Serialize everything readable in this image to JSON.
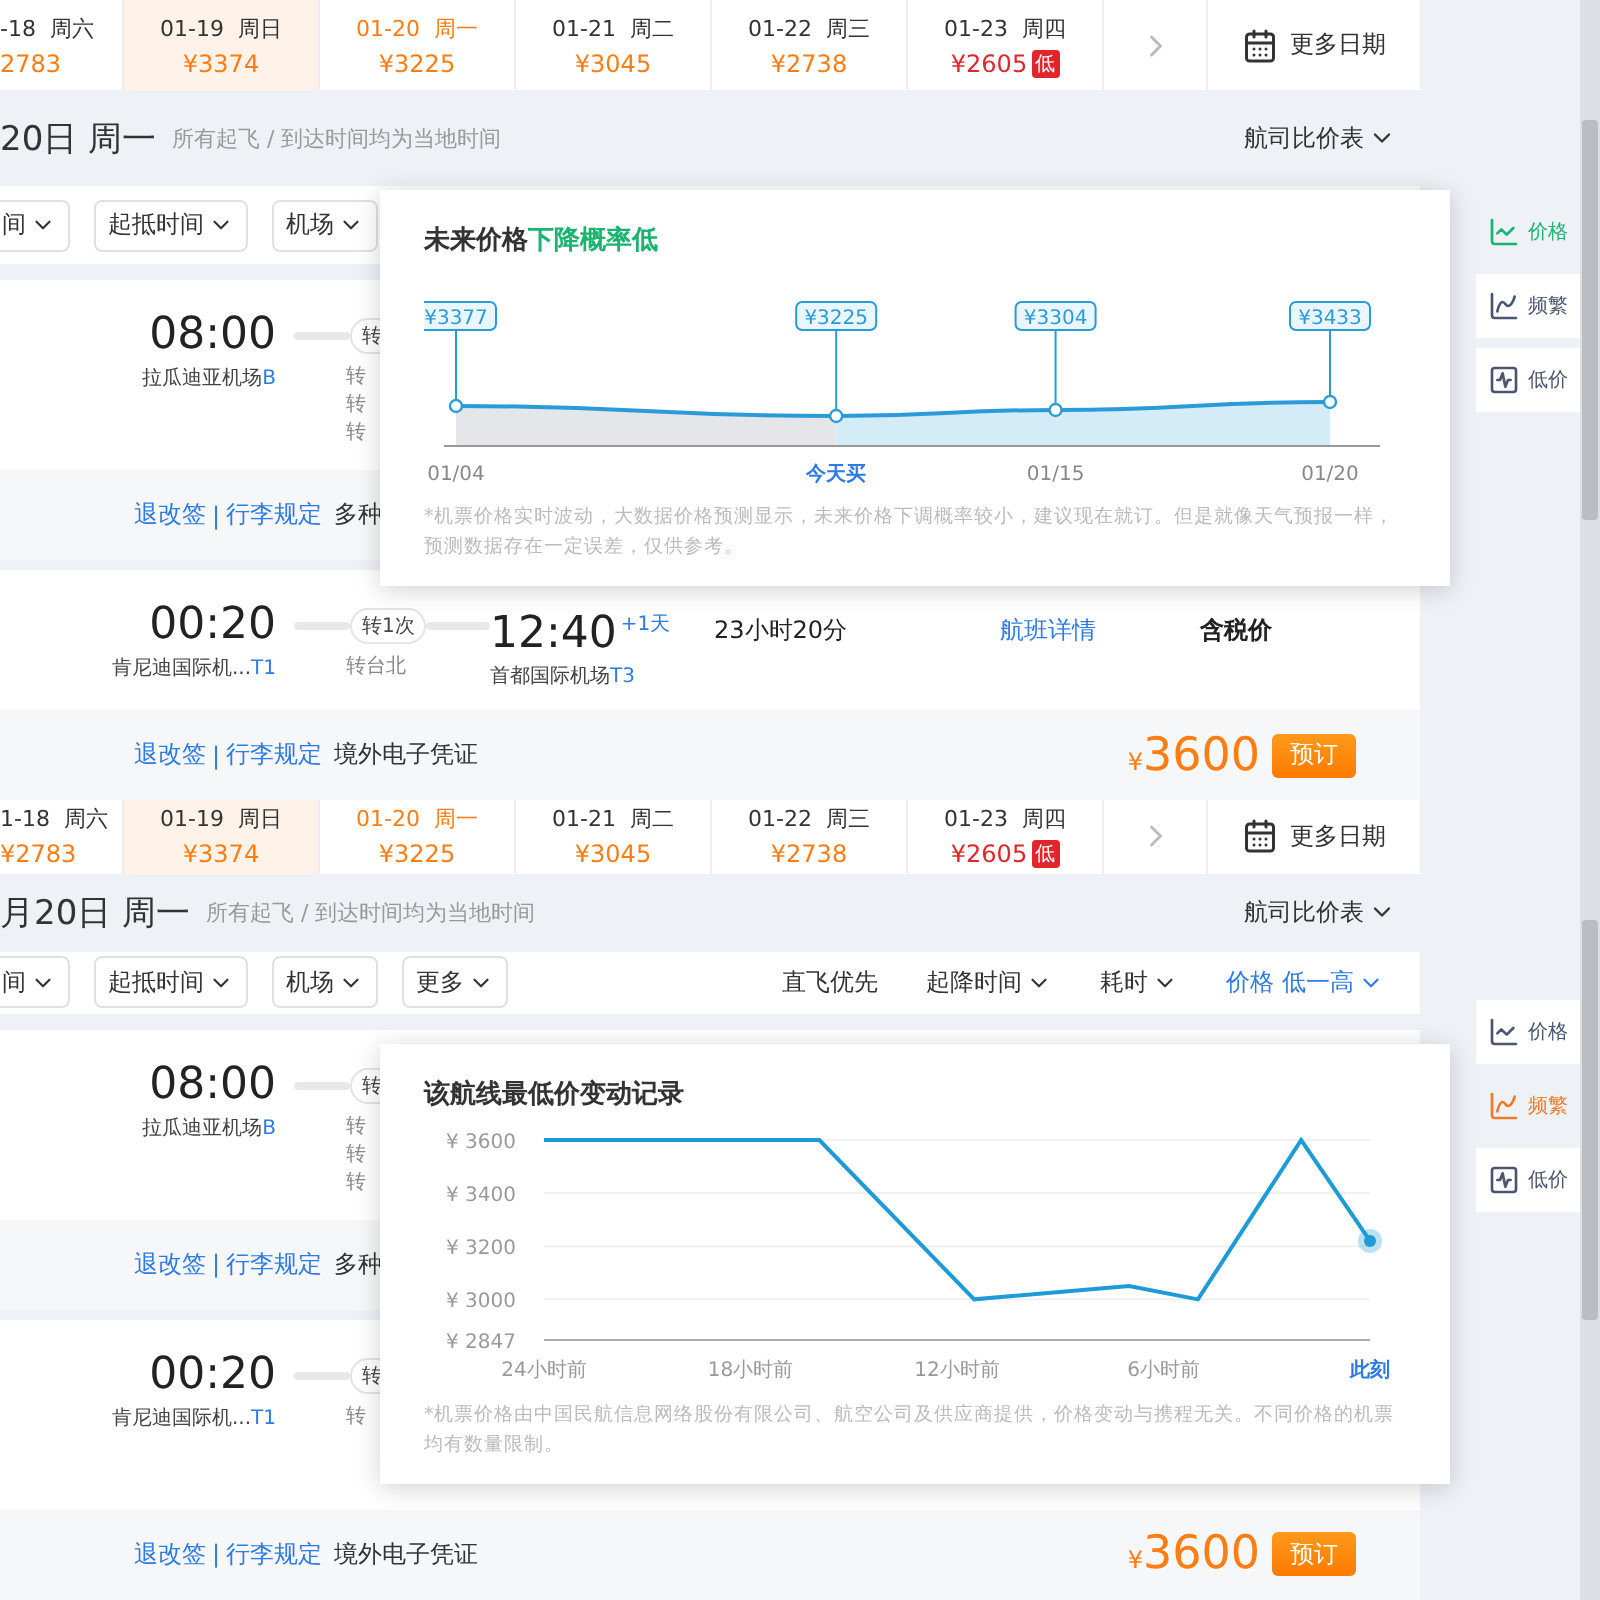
{
  "panels": [
    {
      "dates": [
        {
          "date": "-18",
          "weekday": "周六",
          "price": "2783",
          "selected": false,
          "hovered": false,
          "lowest": false
        },
        {
          "date": "01-19",
          "weekday": "周日",
          "price": "¥3374",
          "selected": false,
          "hovered": true,
          "lowest": false
        },
        {
          "date": "01-20",
          "weekday": "周一",
          "price": "¥3225",
          "selected": true,
          "hovered": false,
          "lowest": false
        },
        {
          "date": "01-21",
          "weekday": "周二",
          "price": "¥3045",
          "selected": false,
          "hovered": false,
          "lowest": false
        },
        {
          "date": "01-22",
          "weekday": "周三",
          "price": "¥2738",
          "selected": false,
          "hovered": false,
          "lowest": false
        },
        {
          "date": "01-23",
          "weekday": "周四",
          "price": "¥2605",
          "selected": false,
          "hovered": false,
          "lowest": true,
          "badge": "低"
        }
      ],
      "more_dates": "更多日期",
      "heading": "20日 周一",
      "note": "所有起飞 / 到达时间均为当地时间",
      "compare": "航司比价表",
      "filters": [
        "间",
        "起抵时间",
        "机场"
      ],
      "tools": [
        {
          "label": "价格",
          "selected": true,
          "color": "#1ab370"
        },
        {
          "label": "频繁",
          "selected": false,
          "color": "#4a5670"
        },
        {
          "label": "低价",
          "selected": false,
          "color": "#4a5670"
        }
      ],
      "flights": [
        {
          "dep_time": "08:00",
          "dep_airport": "拉瓜迪亚机场",
          "dep_terminal": "B",
          "stops": "转",
          "via": [
            "转",
            "转",
            "转"
          ],
          "refund": "退改签",
          "sep": "|",
          "baggage": "行李规定",
          "extra": "多种"
        },
        {
          "dep_time": "00:20",
          "dep_airport": "肯尼迪国际机...",
          "dep_terminal": "T1",
          "stops": "转1次",
          "via": [
            "转台北"
          ],
          "arr_time": "12:40",
          "plus_day": "+1天",
          "arr_airport": "首都国际机场",
          "arr_terminal": "T3",
          "duration": "23小时20分",
          "details": "航班详情",
          "tax": "含税价",
          "refund": "退改签",
          "sep": "|",
          "baggage": "行李规定",
          "extra": "境外电子凭证",
          "currency": "¥",
          "price": "3600",
          "book": "预订"
        }
      ],
      "popup": {
        "kind": "forecast",
        "title": "未来价格",
        "highlight": "下降概率低",
        "price_labels": [
          "¥3377",
          "¥3225",
          "¥3304",
          "¥3433"
        ],
        "axis_labels": [
          {
            "label": "01/04",
            "highlighted": false
          },
          {
            "label": "今天买",
            "highlighted": true
          },
          {
            "label": "01/15",
            "highlighted": false
          },
          {
            "label": "01/20",
            "highlighted": false
          }
        ],
        "note": "*机票价格实时波动，大数据价格预测显示，未来价格下调概率较小，建议现在就订。但是就像天气预报一样，预测数据存在一定误差，仅供参考。"
      }
    },
    {
      "dates": [
        {
          "date": "1-18",
          "weekday": "周六",
          "price": "¥2783",
          "selected": false,
          "hovered": false,
          "lowest": false
        },
        {
          "date": "01-19",
          "weekday": "周日",
          "price": "¥3374",
          "selected": false,
          "hovered": true,
          "lowest": false
        },
        {
          "date": "01-20",
          "weekday": "周一",
          "price": "¥3225",
          "selected": true,
          "hovered": false,
          "lowest": false
        },
        {
          "date": "01-21",
          "weekday": "周二",
          "price": "¥3045",
          "selected": false,
          "hovered": false,
          "lowest": false
        },
        {
          "date": "01-22",
          "weekday": "周三",
          "price": "¥2738",
          "selected": false,
          "hovered": false,
          "lowest": false
        },
        {
          "date": "01-23",
          "weekday": "周四",
          "price": "¥2605",
          "selected": false,
          "hovered": false,
          "lowest": true,
          "badge": "低"
        }
      ],
      "more_dates": "更多日期",
      "heading": "月20日 周一",
      "note": "所有起飞 / 到达时间均为当地时间",
      "compare": "航司比价表",
      "filters": [
        "间",
        "起抵时间",
        "机场",
        "更多"
      ],
      "sorters": [
        {
          "label": "直飞优先",
          "dropdown": false,
          "selected": false
        },
        {
          "label": "起降时间",
          "dropdown": true,
          "selected": false
        },
        {
          "label": "耗时",
          "dropdown": true,
          "selected": false
        },
        {
          "label": "价格 低一高",
          "dropdown": true,
          "selected": true
        }
      ],
      "tools": [
        {
          "label": "价格",
          "selected": false,
          "color": "#4a5670"
        },
        {
          "label": "频繁",
          "selected": true,
          "color": "#f07a2a"
        },
        {
          "label": "低价",
          "selected": false,
          "color": "#4a5670"
        }
      ],
      "flights": [
        {
          "dep_time": "08:00",
          "dep_airport": "拉瓜迪亚机场",
          "dep_terminal": "B",
          "stops": "转",
          "via": [
            "转",
            "转",
            "转"
          ],
          "refund": "退改签",
          "sep": "|",
          "baggage": "行李规定",
          "extra": "多种"
        },
        {
          "dep_time": "00:20",
          "dep_airport": "肯尼迪国际机...",
          "dep_terminal": "T1",
          "stops": "转",
          "via": [
            "转"
          ],
          "refund": "退改签",
          "sep": "|",
          "baggage": "行李规定",
          "extra": "境外电子凭证",
          "currency": "¥",
          "price": "3600",
          "book": "预订"
        }
      ],
      "popup": {
        "kind": "history",
        "title": "该航线最低价变动记录",
        "chart_data": {
          "type": "line",
          "x": [
            -24,
            -16,
            -11.5,
            -7,
            -5,
            -2,
            0
          ],
          "series": [
            {
              "color": "#1e9ad6",
              "values": [
                3600,
                3600,
                3000,
                3050,
                3000,
                3600,
                3220
              ]
            }
          ],
          "xlim": [
            -24,
            0
          ],
          "ylim": [
            2847,
            3600
          ],
          "grid": true,
          "xticks": [
            {
              "value": -24,
              "label": "24小时前"
            },
            {
              "value": -18,
              "label": "18小时前"
            },
            {
              "value": -12,
              "label": "12小时前"
            },
            {
              "value": -6,
              "label": "6小时前"
            },
            {
              "value": 0,
              "label": "此刻"
            }
          ],
          "yticks": [
            {
              "value": 3600,
              "label": "¥ 3600"
            },
            {
              "value": 3400,
              "label": "¥ 3400"
            },
            {
              "value": 3200,
              "label": "¥ 3200"
            },
            {
              "value": 3000,
              "label": "¥ 3000"
            },
            {
              "value": 2847,
              "label": "¥ 2847"
            }
          ]
        },
        "note": "*机票价格由中国民航信息网络股份有限公司、航空公司及供应商提供，价格变动与携程无关。不同价格的机票均有数量限制。"
      }
    }
  ]
}
